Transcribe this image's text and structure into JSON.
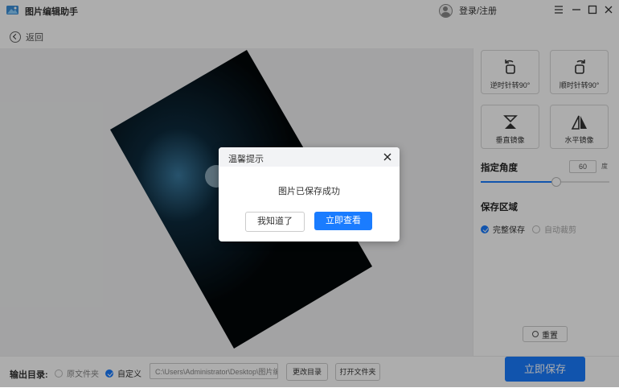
{
  "app": {
    "title": "图片编辑助手",
    "login_label": "登录/注册"
  },
  "nav": {
    "back_label": "返回"
  },
  "tools": {
    "rotate_left": "逆时针转90°",
    "rotate_right": "顺时针转90°",
    "flip_vertical": "垂直镜像",
    "flip_horizontal": "水平镜像"
  },
  "angle": {
    "title": "指定角度",
    "value": "60",
    "unit": "度",
    "slider_fraction": 0.58
  },
  "save_area": {
    "title": "保存区域",
    "options": [
      {
        "label": "完整保存",
        "checked": true
      },
      {
        "label": "自动裁剪",
        "checked": false
      }
    ]
  },
  "reset_label": "重置",
  "output": {
    "label": "输出目录:",
    "options": [
      {
        "label": "原文件夹",
        "checked": false
      },
      {
        "label": "自定义",
        "checked": true
      }
    ],
    "path": "C:\\Users\\Administrator\\Desktop\\图片编辑",
    "change_label": "更改目录",
    "open_label": "打开文件夹"
  },
  "save_button": "立即保存",
  "dialog": {
    "title": "温馨提示",
    "message": "图片已保存成功",
    "ok_label": "我知道了",
    "view_label": "立即查看"
  },
  "colors": {
    "accent": "#1a7cff"
  }
}
